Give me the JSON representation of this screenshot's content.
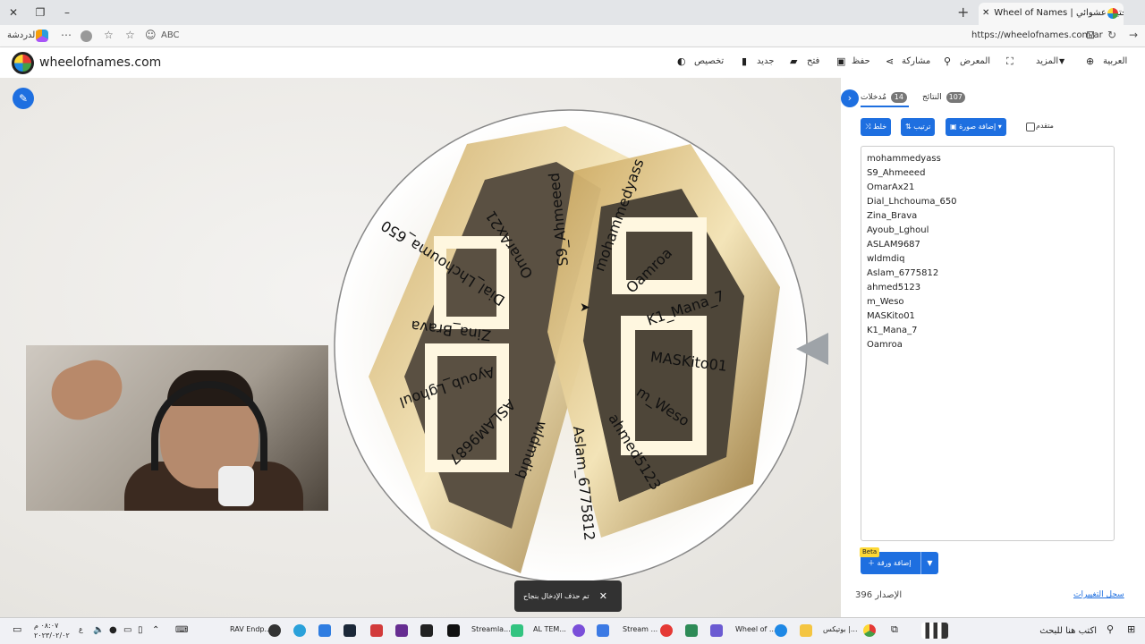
{
  "browser": {
    "tab_title": "Wheel of Names | ‏اختيار عشوائي",
    "new_tab_label": "+",
    "url": "https://wheelofnames.com/ar",
    "profile_label": "الدردشة"
  },
  "header": {
    "site_title": "wheelofnames.com",
    "menu": {
      "customize": "تخصيص",
      "new": "جديد",
      "open": "فتح",
      "save": "حفظ",
      "share": "مشاركة",
      "gallery": "المعرض",
      "more": "المزيد",
      "language": "العربية"
    }
  },
  "wheel": {
    "entries": [
      "mohammedyass",
      "Oamroa",
      "K1_Mana_7",
      "MASKito01",
      "m_Weso",
      "ahmed5123",
      "Aslam_6775812",
      "wldmdiq",
      "ASLAM9687",
      "Ayoub_Lghoul",
      "Zina_Brava",
      "Dial_Lhchouma_650",
      "OmarAx21",
      "S9_Ahmeeed"
    ]
  },
  "panel": {
    "entries_tab": "مُدخلات",
    "entries_count": "14",
    "results_tab": "النتائج",
    "results_count": "107",
    "shuffle": "خلط",
    "sort": "ترتيب",
    "add_image": "إضافة صورة",
    "advanced": "متقدم",
    "entries": [
      "mohammedyass",
      "S9_Ahmeeed",
      "OmarAx21",
      "Dial_Lhchouma_650",
      "Zina_Brava",
      "Ayoub_Lghoul",
      "ASLAM9687",
      "wldmdiq",
      "Aslam_6775812",
      "ahmed5123",
      "m_Weso",
      "MASKito01",
      "K1_Mana_7",
      "Oamroa"
    ],
    "beta": "Beta",
    "add_sheet": "إضافة ورقة",
    "version": "الإصدار 396",
    "changelog": "سجل التغييرات"
  },
  "toast": {
    "message": "تم حذف الإدخال بنجاح",
    "close": "✕"
  },
  "taskbar": {
    "time": "٠٨:٠٧ م",
    "date": "٢٠٢٣/٠٢/٠٢",
    "search_placeholder": "اكتب هنا للبحث",
    "items": [
      "RAV Endp...",
      "Streamla...",
      "AL TEM...",
      "Stream ...",
      "Wheel of ...",
      "بوتيكس |..."
    ]
  }
}
